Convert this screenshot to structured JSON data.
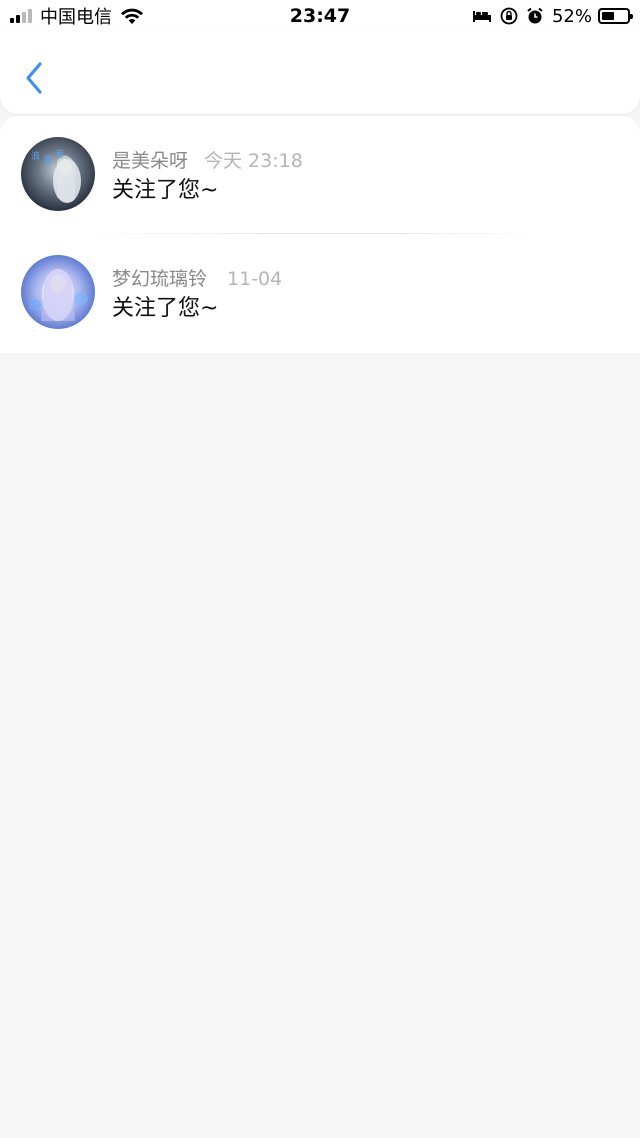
{
  "status_bar": {
    "carrier": "中国电信",
    "time": "23:47",
    "battery_percent": "52%",
    "battery_level": 0.52,
    "icons": [
      "signal-icon",
      "wifi-icon",
      "bed-icon",
      "orientation-lock-icon",
      "alarm-icon",
      "battery-icon"
    ]
  },
  "nav": {
    "back_icon": "chevron-left-icon",
    "accent_color": "#3d8ff0"
  },
  "notifications": [
    {
      "name": "是美朵呀",
      "time": "今天 23:18",
      "message": "关注了您~"
    },
    {
      "name": "梦幻琉璃铃",
      "time": "11-04",
      "message": "关注了您~"
    }
  ],
  "colors": {
    "background": "#f6f6f6",
    "card": "#ffffff",
    "name_text": "#8a8a8a",
    "time_text": "#b5b5b5"
  }
}
